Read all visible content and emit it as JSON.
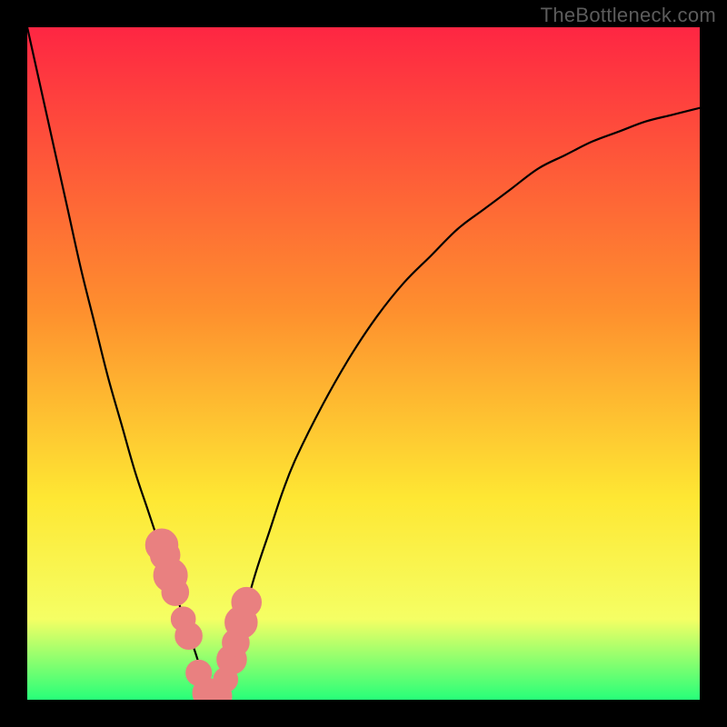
{
  "watermark": "TheBottleneck.com",
  "colors": {
    "frame": "#000000",
    "gradient_top": "#fe2643",
    "gradient_mid1": "#fe8f2e",
    "gradient_mid2": "#fee733",
    "gradient_mid3": "#f5ff64",
    "gradient_bottom": "#27ff79",
    "curve": "#000000",
    "marker_fill": "#e98080",
    "marker_stroke": "#e98080"
  },
  "chart_data": {
    "type": "line",
    "title": "",
    "xlabel": "",
    "ylabel": "",
    "xlim": [
      0,
      100
    ],
    "ylim": [
      0,
      100
    ],
    "grid": false,
    "legend": false,
    "x": [
      0,
      2,
      4,
      6,
      8,
      10,
      12,
      14,
      16,
      18,
      20,
      21,
      22,
      23,
      24,
      25,
      26,
      27,
      28,
      30,
      32,
      34,
      36,
      38,
      40,
      44,
      48,
      52,
      56,
      60,
      64,
      68,
      72,
      76,
      80,
      84,
      88,
      92,
      96,
      100
    ],
    "values": [
      100,
      91,
      82,
      73,
      64,
      56,
      48,
      41,
      34,
      28,
      22,
      19,
      16,
      13,
      10,
      7,
      4,
      2,
      0.5,
      5,
      12,
      19,
      25,
      31,
      36,
      44,
      51,
      57,
      62,
      66,
      70,
      73,
      76,
      79,
      81,
      83,
      84.5,
      86,
      87,
      88
    ],
    "markers": {
      "x": [
        20.0,
        20.5,
        21.3,
        22.0,
        23.2,
        24.0,
        25.5,
        26.8,
        28.0,
        29.5,
        30.4,
        31.0,
        31.8,
        32.6
      ],
      "values": [
        23.0,
        21.5,
        18.5,
        16.0,
        12.0,
        9.5,
        4.0,
        1.0,
        0.5,
        3.0,
        6.0,
        8.5,
        11.5,
        14.5
      ],
      "r": [
        2.4,
        2.2,
        2.5,
        2.0,
        1.8,
        2.0,
        1.9,
        2.2,
        2.4,
        1.8,
        2.2,
        2.0,
        2.4,
        2.2
      ]
    }
  }
}
